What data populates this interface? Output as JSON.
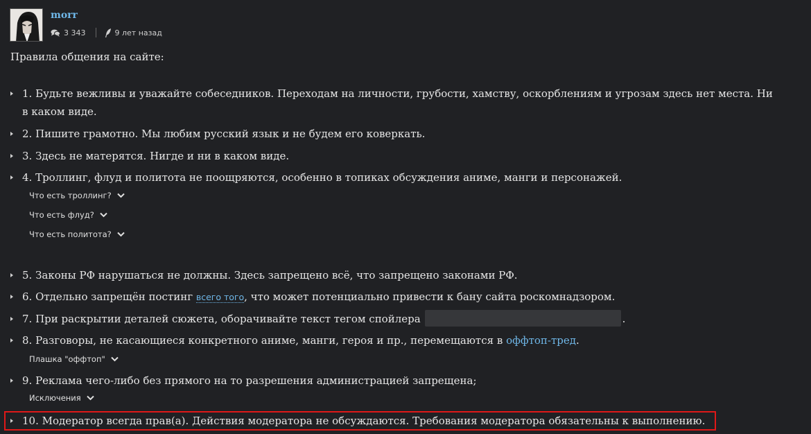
{
  "author": {
    "name": "morr",
    "comments_count": "3 343",
    "posted_ago": "9 лет назад"
  },
  "intro": "Правила общения на сайте:",
  "rules": [
    "1. Будьте вежливы и уважайте собеседников. Переходам на личности, грубости, хамству, оскорблениям и угрозам здесь нет места. Ни в каком виде.",
    "2. Пишите грамотно. Мы любим русский язык и не будем его коверкать.",
    "3. Здесь не матерятся. Нигде и ни в каком виде.",
    "4. Троллинг, флуд и политота не поощряются, особенно в топиках обсуждения аниме, манги и персонажей.",
    "5. Законы РФ нарушаться не должны. Здесь запрещено всё, что запрещено законами РФ.",
    "10. Модератор всегда прав(а). Действия модератора не обсуждаются. Требования модератора обязательны к выполнению."
  ],
  "rule6": {
    "before": "6. Отдельно запрещён постинг ",
    "link": "всего того",
    "after": ", что может потенциально привести к бану сайта роскомнадзором."
  },
  "rule7": {
    "before": "7. При раскрытии деталей сюжета, оборачивайте текст тегом спойлера",
    "after": "."
  },
  "rule8": {
    "before": "8. Разговоры, не касающиеся конкретного аниме, манги, героя и пр., перемещаются в ",
    "link": "оффтоп-тред",
    "after": "."
  },
  "rule9": "9. Реклама чего-либо без прямого на то разрешения администрацией запрещена;",
  "spoilers": {
    "trolling": "Что есть троллинг?",
    "flood": "Что есть флуд?",
    "politics": "Что есть политота?",
    "offtop_badge": "Плашка \"оффтоп\"",
    "exceptions": "Исключения"
  },
  "colors": {
    "background": "#202124",
    "text": "#e6e6e6",
    "link": "#6fb7e8",
    "highlight_border": "#e01818"
  }
}
